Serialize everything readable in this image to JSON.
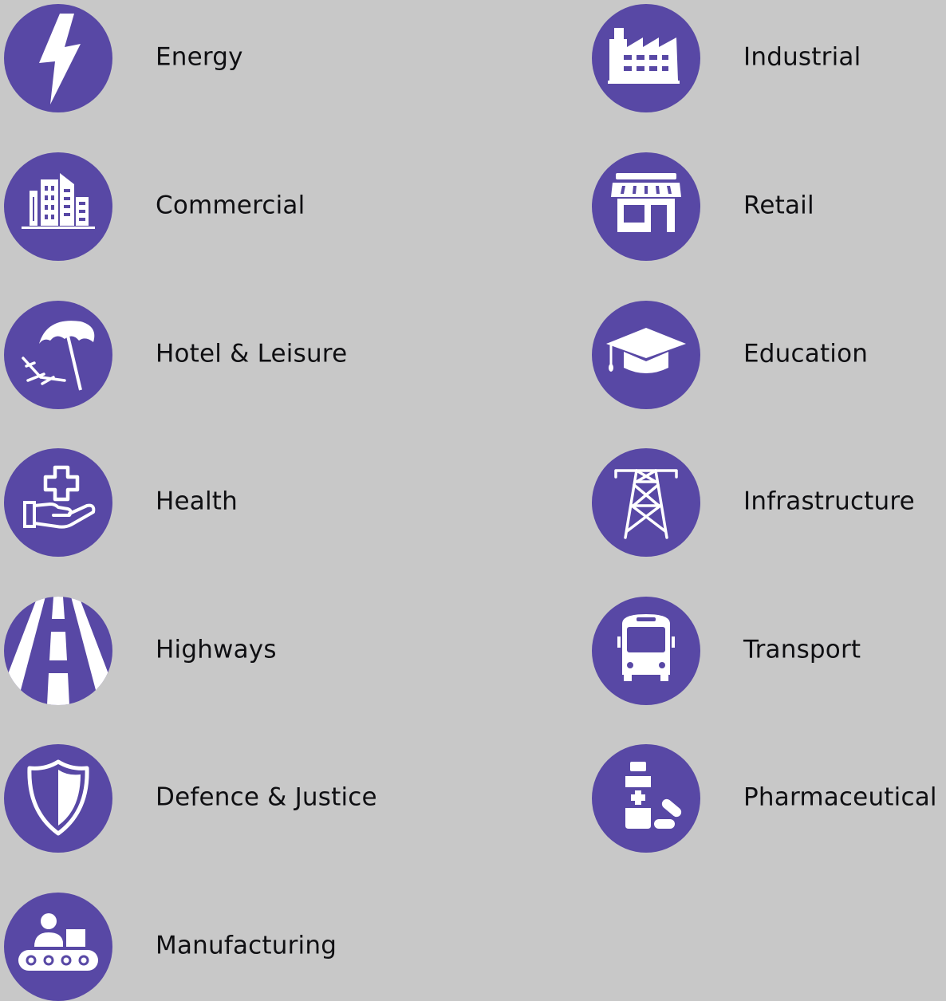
{
  "colors": {
    "background": "#c8c8c8",
    "circle": "#5848a5",
    "icon": "#ffffff",
    "text": "#0f0f12"
  },
  "sectors": [
    {
      "label": "Energy",
      "icon": "lightning-bolt-icon"
    },
    {
      "label": "Industrial",
      "icon": "factory-icon"
    },
    {
      "label": "Commercial",
      "icon": "office-buildings-icon"
    },
    {
      "label": "Retail",
      "icon": "storefront-icon"
    },
    {
      "label": "Hotel & Leisure",
      "icon": "beach-umbrella-icon"
    },
    {
      "label": "Education",
      "icon": "graduation-cap-icon"
    },
    {
      "label": "Health",
      "icon": "medical-cross-hand-icon"
    },
    {
      "label": "Infrastructure",
      "icon": "pylon-icon"
    },
    {
      "label": "Highways",
      "icon": "road-icon"
    },
    {
      "label": "Transport",
      "icon": "bus-icon"
    },
    {
      "label": "Defence & Justice",
      "icon": "shield-icon"
    },
    {
      "label": "Pharmaceutical",
      "icon": "medicine-pills-icon"
    },
    {
      "label": "Manufacturing",
      "icon": "conveyor-belt-icon"
    }
  ]
}
